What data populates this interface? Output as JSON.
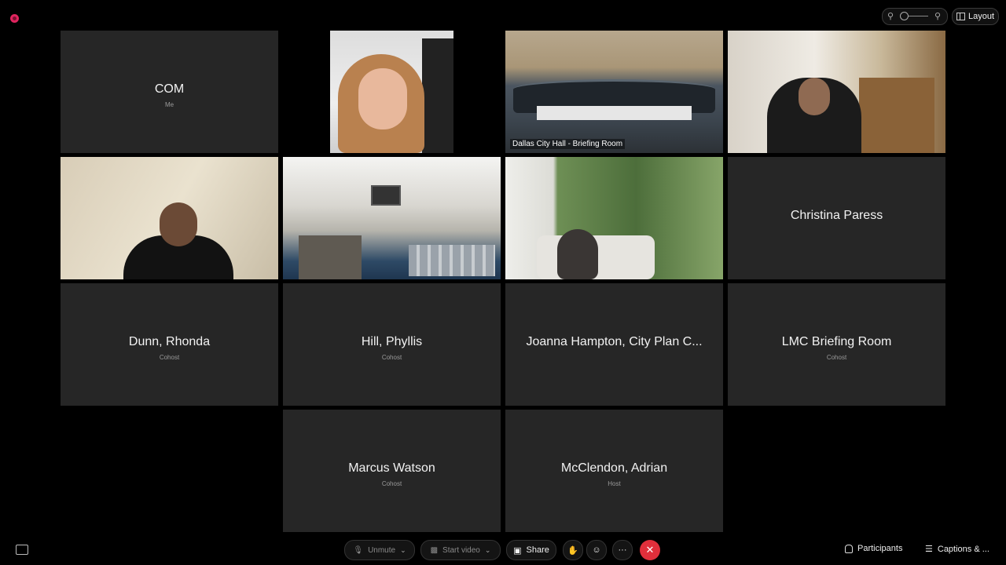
{
  "zoom": {
    "out_icon": "zoom-out-icon",
    "in_icon": "zoom-in-icon"
  },
  "layout_label": "Layout",
  "tiles": [
    {
      "name": "COM",
      "role": "Me"
    },
    {
      "caption": "Dallas City Hall - Briefing Room"
    },
    {
      "name": "Christina Paress"
    },
    {
      "name": "Dunn, Rhonda",
      "role": "Cohost"
    },
    {
      "name": "Hill, Phyllis",
      "role": "Cohost"
    },
    {
      "name": "Joanna Hampton, City Plan C..."
    },
    {
      "name": "LMC Briefing Room",
      "role": "Cohost"
    },
    {
      "name": "Marcus Watson",
      "role": "Cohost"
    },
    {
      "name": "McClendon, Adrian",
      "role": "Host"
    }
  ],
  "controls": {
    "unmute": "Unmute",
    "start_video": "Start video",
    "share": "Share",
    "more": "···",
    "participants": "Participants",
    "captions": "Captions & ..."
  },
  "colors": {
    "active_border": "#5ca8e8",
    "end_button": "#e02f3b",
    "tile_bg": "#262626"
  }
}
